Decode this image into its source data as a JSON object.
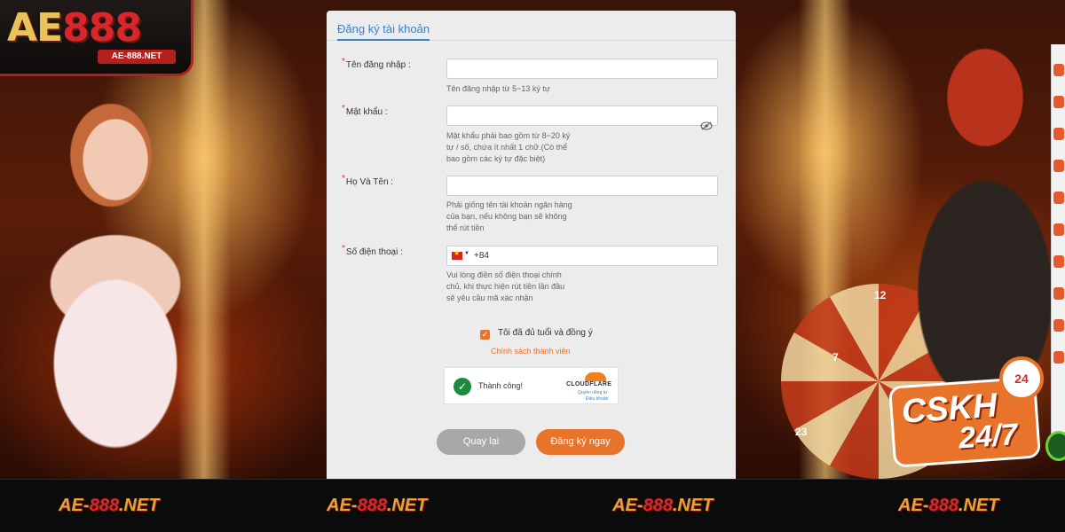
{
  "brand": {
    "logo_part1": "AE",
    "logo_part2": "888",
    "logo_domain": "AE-888.NET"
  },
  "form": {
    "tab_title": "Đăng ký tài khoản",
    "username": {
      "label": "Tên đăng nhập :",
      "value": "",
      "hint": "Tên đăng nhập từ 5~13 ký tự"
    },
    "password": {
      "label": "Mật khẩu :",
      "value": "",
      "hint": "Mật khẩu phải bao gồm từ 8~20 ký tự / số, chứa ít nhất 1 chữ.(Có thể bao gồm các ký tự đặc biệt)",
      "toggle_icon": "eye-off-icon"
    },
    "fullname": {
      "label": "Họ Và Tên :",
      "value": "",
      "hint": "Phải giống tên tài khoản ngân hàng của bạn, nếu không bạn sẽ không thể rút tiền"
    },
    "phone": {
      "label": "Số điện thoại :",
      "country_flag": "vietnam-flag-icon",
      "country_code": "+84",
      "value": "",
      "hint": "Vui lòng điền số điện thoại chính chủ, khi thực hiện rút tiền lần đầu sẽ yêu cầu mã xác nhận"
    },
    "agree": {
      "checked": true,
      "text": "Tôi đã đủ tuổi và đồng ý",
      "policy_link": "Chính sách thành viên"
    },
    "captcha": {
      "status": "Thành công!",
      "provider": "CLOUDFLARE",
      "privacy_link": "Quyền riêng tư",
      "terms_link": "Điều khoản"
    },
    "back_button": "Quay lại",
    "register_button": "Đăng ký ngay"
  },
  "support": {
    "title": "CSKH",
    "subtitle": "24/7",
    "clock_label": "24"
  },
  "footer": {
    "watermark": "AE-888.NET",
    "wm_prefix": "AE-",
    "wm_num": "888",
    "wm_suffix": ".NET"
  },
  "wheel_numbers": [
    "12",
    "7",
    "23"
  ],
  "colors": {
    "accent": "#e8742c",
    "link": "#3a7fc2",
    "required": "#e23b2b",
    "success": "#1e8a3c"
  }
}
